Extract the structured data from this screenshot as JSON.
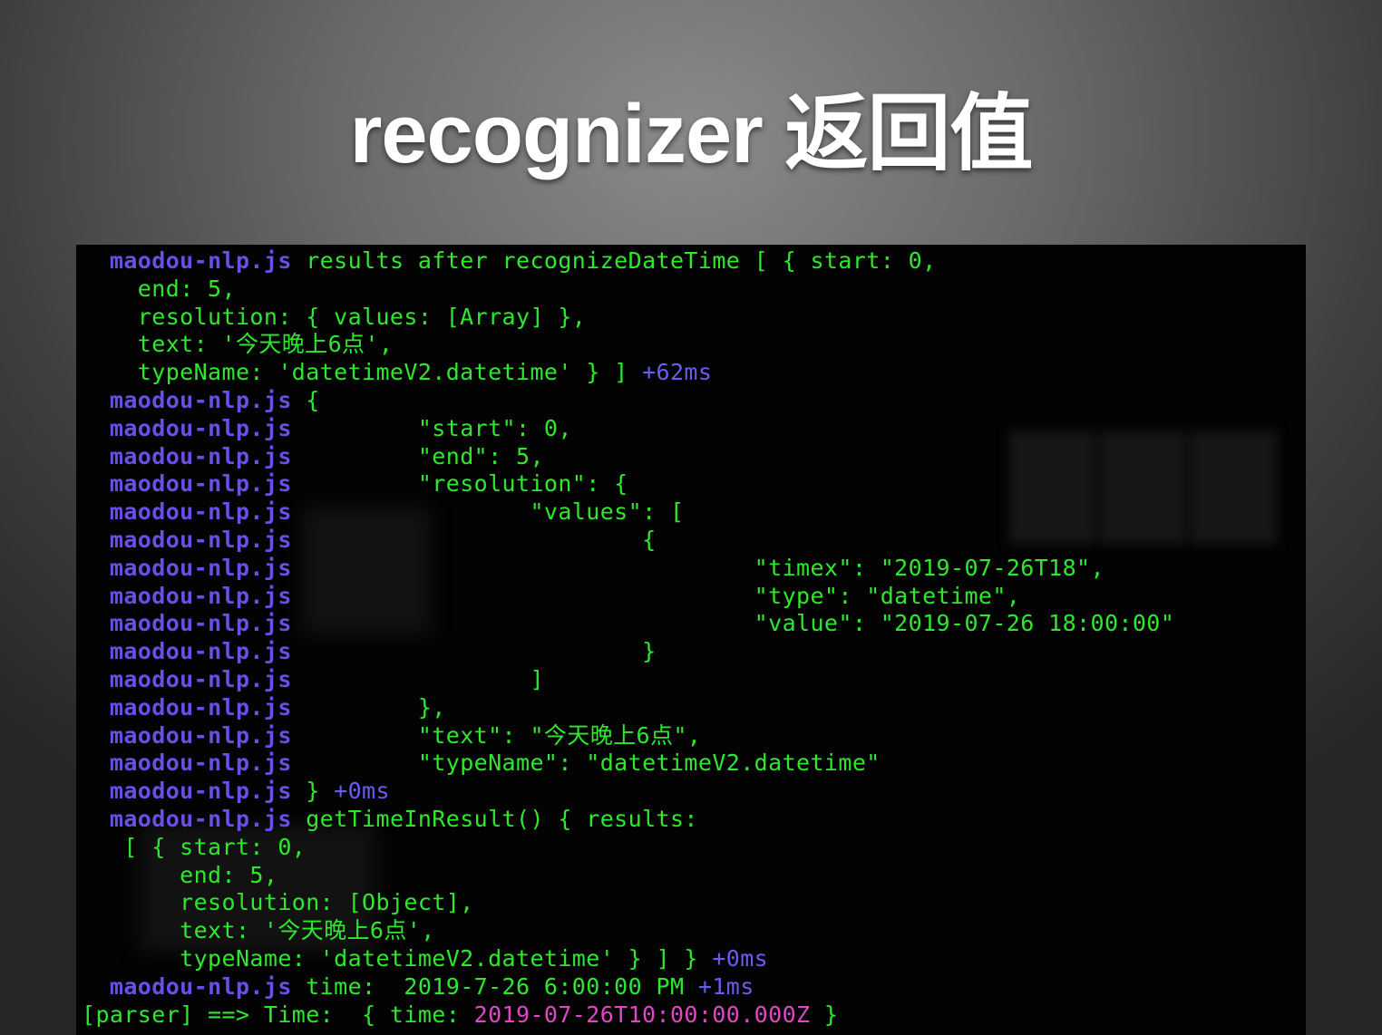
{
  "slide": {
    "title": "recognizer 返回值"
  },
  "terminal": {
    "lines": [
      {
        "segments": [
          {
            "t": "  "
          },
          {
            "t": "maodou-nlp.js",
            "c": "pfx"
          },
          {
            "t": " results after recognizeDateTime [ { start: 0,",
            "c": "g"
          }
        ]
      },
      {
        "segments": [
          {
            "t": "    end: 5,",
            "c": "g"
          }
        ]
      },
      {
        "segments": [
          {
            "t": "    resolution: { values: [Array] },",
            "c": "g"
          }
        ]
      },
      {
        "segments": [
          {
            "t": "    text: '今天晚上6点',",
            "c": "g"
          }
        ]
      },
      {
        "segments": [
          {
            "t": "    typeName: 'datetimeV2.datetime' } ] ",
            "c": "g"
          },
          {
            "t": "+62ms",
            "c": "b"
          }
        ]
      },
      {
        "segments": [
          {
            "t": "  "
          },
          {
            "t": "maodou-nlp.js",
            "c": "pfx"
          },
          {
            "t": " {",
            "c": "g"
          }
        ]
      },
      {
        "segments": [
          {
            "t": "  "
          },
          {
            "t": "maodou-nlp.js",
            "c": "pfx"
          },
          {
            "t": "         \"start\": 0,",
            "c": "g"
          }
        ]
      },
      {
        "segments": [
          {
            "t": "  "
          },
          {
            "t": "maodou-nlp.js",
            "c": "pfx"
          },
          {
            "t": "         \"end\": 5,",
            "c": "g"
          }
        ]
      },
      {
        "segments": [
          {
            "t": "  "
          },
          {
            "t": "maodou-nlp.js",
            "c": "pfx"
          },
          {
            "t": "         \"resolution\": {",
            "c": "g"
          }
        ]
      },
      {
        "segments": [
          {
            "t": "  "
          },
          {
            "t": "maodou-nlp.js",
            "c": "pfx"
          },
          {
            "t": "                 \"values\": [",
            "c": "g"
          }
        ]
      },
      {
        "segments": [
          {
            "t": "  "
          },
          {
            "t": "maodou-nlp.js",
            "c": "pfx"
          },
          {
            "t": "                         {",
            "c": "g"
          }
        ]
      },
      {
        "segments": [
          {
            "t": "  "
          },
          {
            "t": "maodou-nlp.js",
            "c": "pfx"
          },
          {
            "t": "                                 \"timex\": \"2019-07-26T18\",",
            "c": "g"
          }
        ]
      },
      {
        "segments": [
          {
            "t": "  "
          },
          {
            "t": "maodou-nlp.js",
            "c": "pfx"
          },
          {
            "t": "                                 \"type\": \"datetime\",",
            "c": "g"
          }
        ]
      },
      {
        "segments": [
          {
            "t": "  "
          },
          {
            "t": "maodou-nlp.js",
            "c": "pfx"
          },
          {
            "t": "                                 \"value\": \"2019-07-26 18:00:00\"",
            "c": "g"
          }
        ]
      },
      {
        "segments": [
          {
            "t": "  "
          },
          {
            "t": "maodou-nlp.js",
            "c": "pfx"
          },
          {
            "t": "                         }",
            "c": "g"
          }
        ]
      },
      {
        "segments": [
          {
            "t": "  "
          },
          {
            "t": "maodou-nlp.js",
            "c": "pfx"
          },
          {
            "t": "                 ]",
            "c": "g"
          }
        ]
      },
      {
        "segments": [
          {
            "t": "  "
          },
          {
            "t": "maodou-nlp.js",
            "c": "pfx"
          },
          {
            "t": "         },",
            "c": "g"
          }
        ]
      },
      {
        "segments": [
          {
            "t": "  "
          },
          {
            "t": "maodou-nlp.js",
            "c": "pfx"
          },
          {
            "t": "         \"text\": \"今天晚上6点\",",
            "c": "g"
          }
        ]
      },
      {
        "segments": [
          {
            "t": "  "
          },
          {
            "t": "maodou-nlp.js",
            "c": "pfx"
          },
          {
            "t": "         \"typeName\": \"datetimeV2.datetime\"",
            "c": "g"
          }
        ]
      },
      {
        "segments": [
          {
            "t": "  "
          },
          {
            "t": "maodou-nlp.js",
            "c": "pfx"
          },
          {
            "t": " } ",
            "c": "g"
          },
          {
            "t": "+0ms",
            "c": "b"
          }
        ]
      },
      {
        "segments": [
          {
            "t": "  "
          },
          {
            "t": "maodou-nlp.js",
            "c": "pfx"
          },
          {
            "t": " getTimeInResult() { results:",
            "c": "g"
          }
        ]
      },
      {
        "segments": [
          {
            "t": "   [ { start: 0,",
            "c": "g"
          }
        ]
      },
      {
        "segments": [
          {
            "t": "       end: 5,",
            "c": "g"
          }
        ]
      },
      {
        "segments": [
          {
            "t": "       resolution: [Object],",
            "c": "g"
          }
        ]
      },
      {
        "segments": [
          {
            "t": "       text: '今天晚上6点',",
            "c": "g"
          }
        ]
      },
      {
        "segments": [
          {
            "t": "       typeName: 'datetimeV2.datetime' } ] } ",
            "c": "g"
          },
          {
            "t": "+0ms",
            "c": "b"
          }
        ]
      },
      {
        "segments": [
          {
            "t": "  "
          },
          {
            "t": "maodou-nlp.js",
            "c": "pfx"
          },
          {
            "t": " time:  2019-7-26 6:00:00 PM ",
            "c": "g"
          },
          {
            "t": "+1ms",
            "c": "b"
          }
        ]
      },
      {
        "segments": [
          {
            "t": "[parser] ==> Time:  { time: ",
            "c": "g"
          },
          {
            "t": "2019-07-26T10:00:00.000Z",
            "c": "m"
          },
          {
            "t": " }",
            "c": "g"
          }
        ]
      }
    ]
  },
  "colors": {
    "prefix": "#6b4de8",
    "text_green": "#2ee82e",
    "timing_blue": "#6a5cf0",
    "iso_magenta": "#e245c9",
    "terminal_bg": "#030303"
  }
}
